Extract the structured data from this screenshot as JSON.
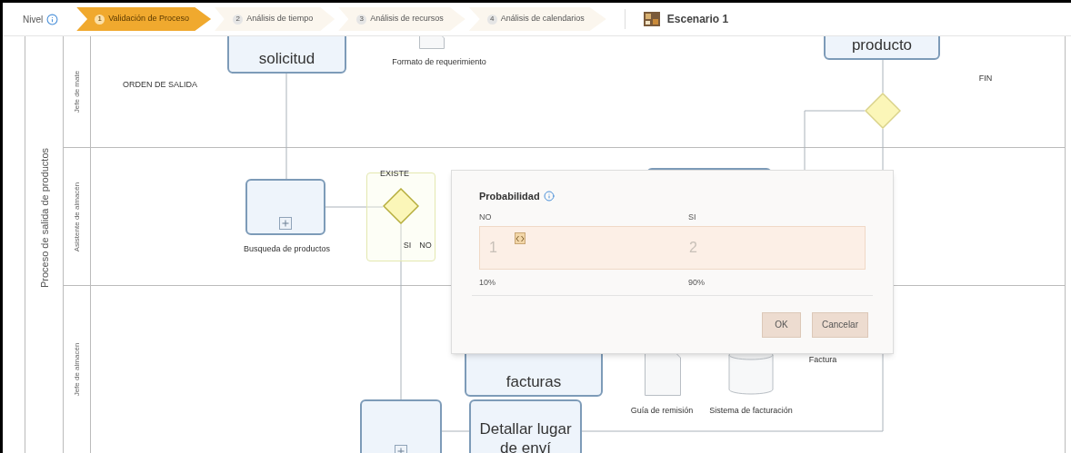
{
  "toolbar": {
    "level_label": "Nivel",
    "steps": [
      {
        "number": "1",
        "label": "Validación de Proceso",
        "selected": true
      },
      {
        "number": "2",
        "label": "Análisis de tiempo",
        "selected": false
      },
      {
        "number": "3",
        "label": "Análisis de recursos",
        "selected": false
      },
      {
        "number": "4",
        "label": "Análisis de calendarios",
        "selected": false
      }
    ],
    "scenario": "Escenario 1"
  },
  "pool": {
    "title": "Proceso de salida de productos",
    "lanes": [
      {
        "name": "Jefe de mate"
      },
      {
        "name": "Asistente de almacén"
      },
      {
        "name": "Jefe de almacén"
      }
    ]
  },
  "nodes": [
    {
      "kind": "label",
      "label": "ORDEN DE SALIDA"
    },
    {
      "kind": "task",
      "label": "solicitud",
      "subprocess": false
    },
    {
      "kind": "data_object"
    },
    {
      "kind": "label",
      "label": "Formato de requerimiento"
    },
    {
      "kind": "task",
      "label": "producto",
      "subprocess": false
    },
    {
      "kind": "label",
      "label": "FIN"
    },
    {
      "kind": "gateway",
      "selected": false
    },
    {
      "kind": "task",
      "subprocess": true
    },
    {
      "kind": "label",
      "label": "Busqueda de productos"
    },
    {
      "kind": "gateway",
      "label": "EXISTE",
      "selected": true
    },
    {
      "kind": "label",
      "label": "SI"
    },
    {
      "kind": "label",
      "label": "NO"
    },
    {
      "kind": "task"
    },
    {
      "kind": "task",
      "label": "facturas",
      "subprocess": false
    },
    {
      "kind": "data_object"
    },
    {
      "kind": "data_store"
    },
    {
      "kind": "label",
      "label": "Factura"
    },
    {
      "kind": "label",
      "label": "Guía de remisión"
    },
    {
      "kind": "label",
      "label": "Sistema de facturación"
    },
    {
      "kind": "task",
      "subprocess": true
    },
    {
      "kind": "task",
      "label": "Detallar lugar de enví",
      "subprocess": false
    }
  ],
  "dialog": {
    "title": "Probabilidad",
    "columns": [
      "NO",
      "SI"
    ],
    "slider": {
      "segments": [
        "1",
        "2"
      ],
      "level": 0.1
    },
    "percentages": [
      "10%",
      "90%"
    ],
    "buttons": [
      "OK",
      "Cancelar"
    ]
  }
}
